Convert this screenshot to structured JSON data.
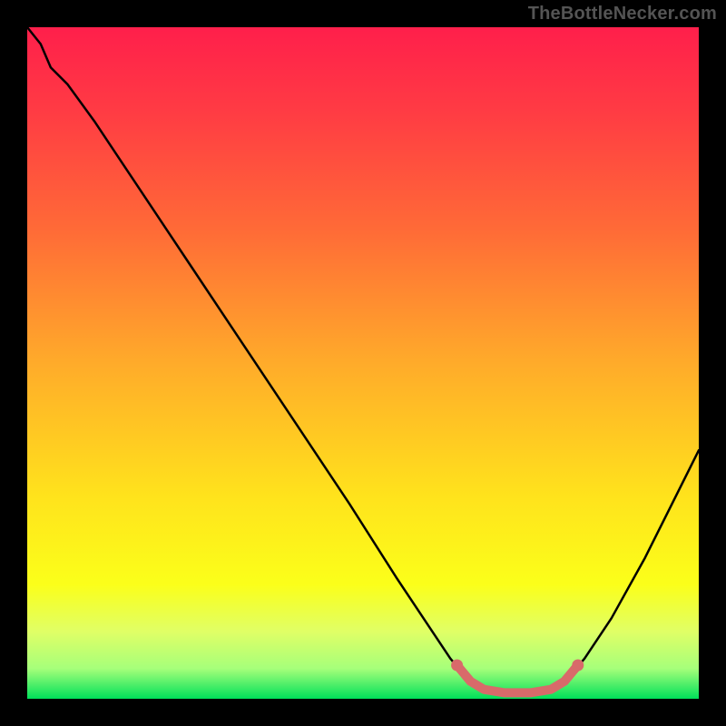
{
  "watermark": "TheBottleNecker.com",
  "chart_data": {
    "type": "line",
    "title": "",
    "xlabel": "",
    "ylabel": "",
    "xlim": [
      0,
      100
    ],
    "ylim": [
      0,
      100
    ],
    "gradient_stops": [
      {
        "offset": 0.0,
        "color": "#ff1f4b"
      },
      {
        "offset": 0.12,
        "color": "#ff3a44"
      },
      {
        "offset": 0.3,
        "color": "#ff6a37"
      },
      {
        "offset": 0.5,
        "color": "#ffab2a"
      },
      {
        "offset": 0.7,
        "color": "#ffe31c"
      },
      {
        "offset": 0.83,
        "color": "#fbff1a"
      },
      {
        "offset": 0.9,
        "color": "#e0ff66"
      },
      {
        "offset": 0.955,
        "color": "#a6ff7a"
      },
      {
        "offset": 1.0,
        "color": "#00e05a"
      }
    ],
    "curve_points": [
      {
        "x": 0.0,
        "y": 100.0
      },
      {
        "x": 2.0,
        "y": 97.5
      },
      {
        "x": 3.5,
        "y": 94.0
      },
      {
        "x": 6.0,
        "y": 91.5
      },
      {
        "x": 10.0,
        "y": 86.0
      },
      {
        "x": 16.0,
        "y": 77.0
      },
      {
        "x": 24.0,
        "y": 65.0
      },
      {
        "x": 32.0,
        "y": 53.0
      },
      {
        "x": 40.0,
        "y": 41.0
      },
      {
        "x": 48.0,
        "y": 29.0
      },
      {
        "x": 55.0,
        "y": 18.0
      },
      {
        "x": 60.0,
        "y": 10.5
      },
      {
        "x": 63.0,
        "y": 6.0
      },
      {
        "x": 65.5,
        "y": 3.0
      },
      {
        "x": 68.0,
        "y": 1.4
      },
      {
        "x": 71.0,
        "y": 0.9
      },
      {
        "x": 75.0,
        "y": 0.9
      },
      {
        "x": 78.0,
        "y": 1.4
      },
      {
        "x": 80.5,
        "y": 3.0
      },
      {
        "x": 83.0,
        "y": 6.0
      },
      {
        "x": 87.0,
        "y": 12.0
      },
      {
        "x": 92.0,
        "y": 21.0
      },
      {
        "x": 96.0,
        "y": 29.0
      },
      {
        "x": 100.0,
        "y": 37.0
      }
    ],
    "highlight_band": {
      "color": "#d86a6a",
      "points": [
        {
          "x": 64.0,
          "y": 5.0
        },
        {
          "x": 66.0,
          "y": 2.6
        },
        {
          "x": 68.0,
          "y": 1.4
        },
        {
          "x": 71.0,
          "y": 0.9
        },
        {
          "x": 75.0,
          "y": 0.9
        },
        {
          "x": 78.0,
          "y": 1.4
        },
        {
          "x": 80.0,
          "y": 2.6
        },
        {
          "x": 82.0,
          "y": 5.0
        }
      ],
      "end_dots": [
        {
          "x": 64.0,
          "y": 5.0
        },
        {
          "x": 82.0,
          "y": 5.0
        }
      ]
    }
  }
}
